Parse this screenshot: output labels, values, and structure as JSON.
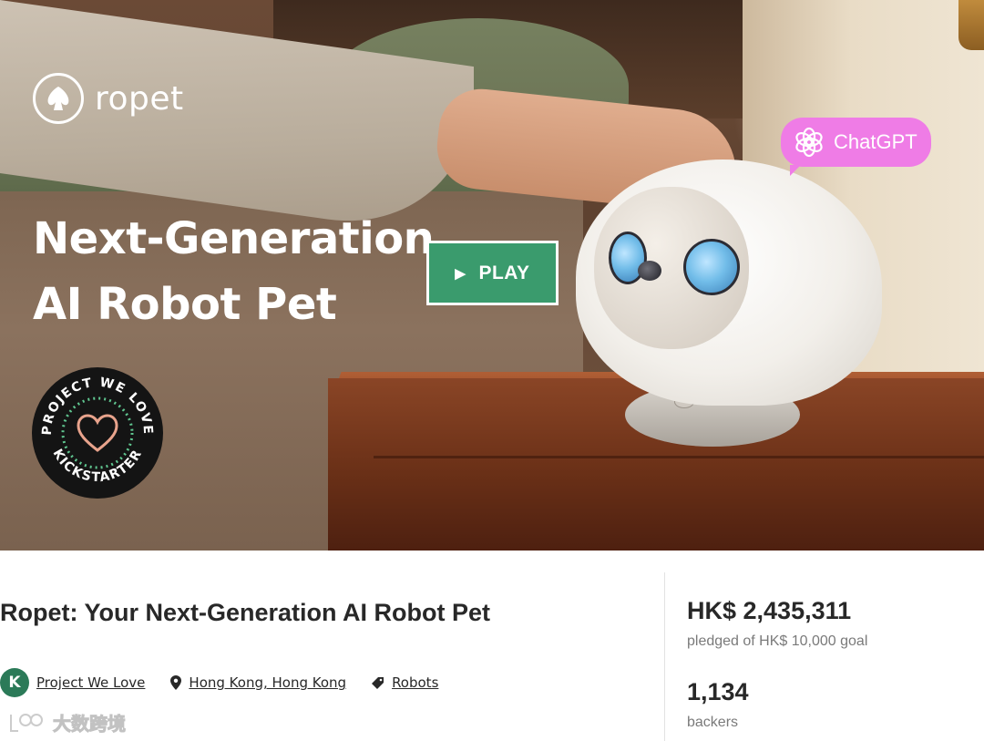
{
  "hero": {
    "brand_name": "ropet",
    "headline_line1": "Next-Generation",
    "headline_line2": "AI Robot Pet",
    "play_label": "PLAY",
    "chatgpt_label": "ChatGPT",
    "badge_top_text": "PROJECT WE LOVE",
    "badge_bottom_text": "KICKSTARTER"
  },
  "project": {
    "title": "Ropet: Your Next-Generation AI Robot Pet",
    "meta": {
      "project_we_love": "Project We Love",
      "location": "Hong Kong, Hong Kong",
      "category": "Robots"
    }
  },
  "stats": {
    "pledged": "HK$ 2,435,311",
    "goal_text": "pledged of HK$ 10,000 goal",
    "backers": "1,134",
    "backers_label": "backers"
  },
  "watermark": {
    "text": "大数跨境"
  },
  "colors": {
    "kickstarter_green": "#3a9b6d",
    "chatgpt_pink": "#ef7ce6",
    "text_dark": "#282828",
    "text_muted": "#7a7a7a"
  },
  "icons": {
    "play": "play-icon",
    "location": "location-pin-icon",
    "category": "tag-icon",
    "chatgpt": "openai-logo-icon",
    "kickstarter": "kickstarter-k-icon",
    "heart": "heart-icon"
  }
}
